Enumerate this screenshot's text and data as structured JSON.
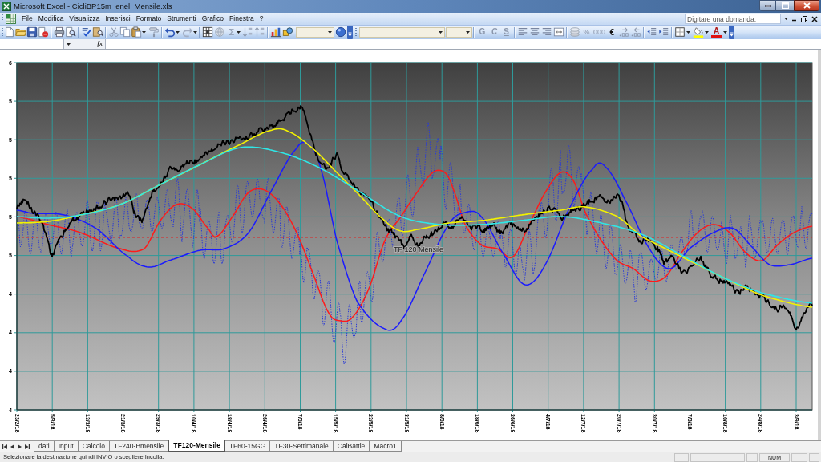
{
  "window": {
    "title": "Microsoft Excel - CicliBP15m_enel_Mensile.xls"
  },
  "menu_bar": {
    "items": [
      "File",
      "Modifica",
      "Visualizza",
      "Inserisci",
      "Formato",
      "Strumenti",
      "Grafico",
      "Finestra",
      "?"
    ],
    "help_search": {
      "placeholder": "Digitare una domanda."
    }
  },
  "standard_toolbar": {
    "autosum_label": "Σ"
  },
  "formatting_toolbar": {
    "style_buttons": [
      "G",
      "C",
      "S"
    ],
    "number_buttons": [
      "%",
      "000",
      "€"
    ],
    "font_color_label": "A"
  },
  "formula_bar": {
    "function_label": "fx"
  },
  "chart": {
    "title": "TF 120 Mensile",
    "y_axis_labels": [
      "6",
      "5",
      "5",
      "5",
      "5",
      "5",
      "4",
      "4",
      "4",
      "4"
    ],
    "x_axis_labels": [
      "23/2/18",
      "5/3/18",
      "13/3/18",
      "21/3/18",
      "29/3/18",
      "10/4/18",
      "18/4/18",
      "26/4/18",
      "7/5/18",
      "15/5/18",
      "23/5/18",
      "31/5/18",
      "8/6/18",
      "18/6/18",
      "26/6/18",
      "4/7/18",
      "12/7/18",
      "20/7/18",
      "30/7/18",
      "7/8/18",
      "16/8/18",
      "24/8/18",
      "3/9/18"
    ]
  },
  "sheet_tabs": [
    {
      "label": "dati",
      "selected": false
    },
    {
      "label": "Input",
      "selected": false
    },
    {
      "label": "Calcolo",
      "selected": false
    },
    {
      "label": "TF240-Bmensile",
      "selected": false
    },
    {
      "label": "TF120-Mensile",
      "selected": true
    },
    {
      "label": "TF60-15GG",
      "selected": false
    },
    {
      "label": "TF30-Settimanale",
      "selected": false
    },
    {
      "label": "CalBattle",
      "selected": false
    },
    {
      "label": "Macro1",
      "selected": false
    }
  ],
  "status_bar": {
    "message": "Selezionare la destinazione quindi INVIO o scegliere Incolla.",
    "indicators": [
      "NUM"
    ]
  }
}
